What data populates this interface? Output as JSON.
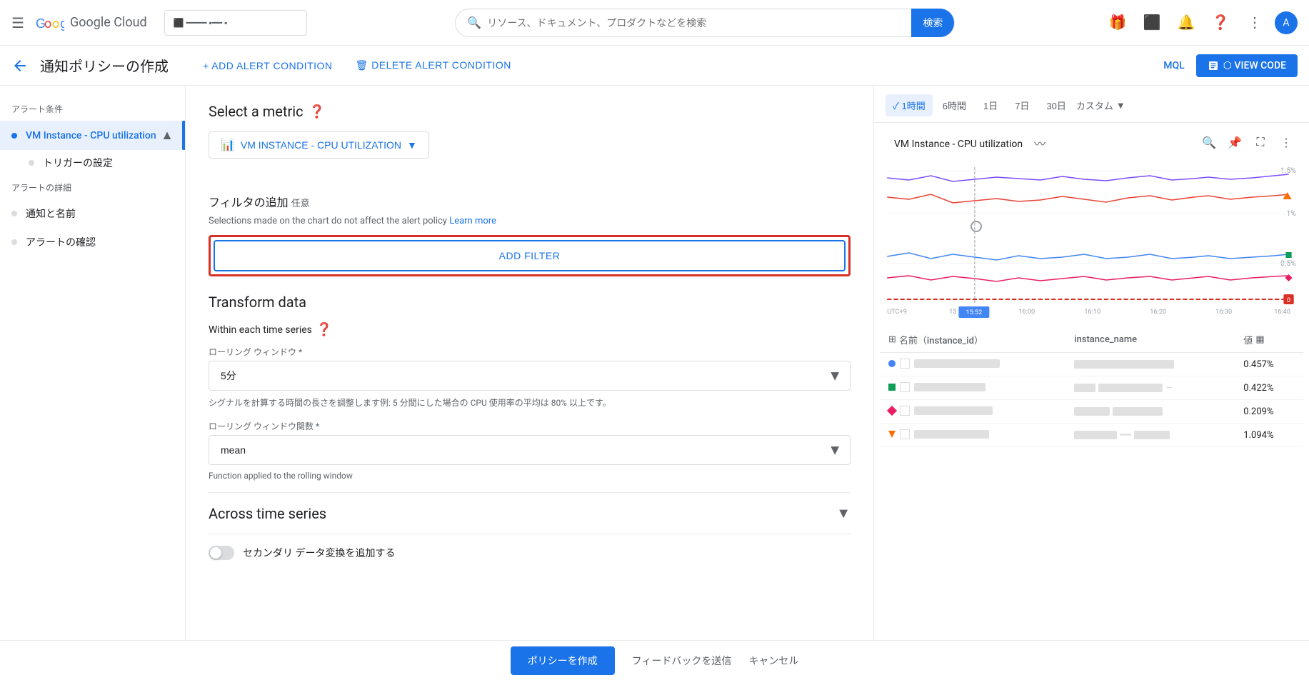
{
  "navbar": {
    "menu_icon": "☰",
    "logo_text": "Google Cloud",
    "search_placeholder": "リソース、ドキュメント、プロダクトなどを検索",
    "search_btn_label": "検索",
    "project_selector_text": "● ▪ ━━ ▪",
    "icons": [
      "gift",
      "monitor",
      "bell",
      "help",
      "more",
      "avatar"
    ]
  },
  "subheader": {
    "back_icon": "←",
    "page_title": "通知ポリシーの作成",
    "add_condition_label": "+ ADD ALERT CONDITION",
    "delete_condition_label": "🗑 DELETE ALERT CONDITION",
    "mql_label": "MQL",
    "view_code_label": "⬡ VIEW CODE"
  },
  "sidebar": {
    "alert_conditions_title": "アラート条件",
    "main_item_label": "VM Instance - CPU utilization",
    "sub_item_label": "トリガーの設定",
    "alert_details_title": "アラートの詳細",
    "notifications_label": "通知と名前",
    "review_label": "アラートの確認"
  },
  "main": {
    "metric_title": "Select a metric",
    "metric_btn_label": "VM INSTANCE - CPU UTILIZATION",
    "filter_title": "フィルタの追加",
    "filter_optional": "任意",
    "filter_description": "Selections made on the chart do not affect the alert policy",
    "filter_learn_more": "Learn more",
    "add_filter_label": "ADD FILTER",
    "transform_title": "Transform data",
    "within_series_title": "Within each time series",
    "rolling_window_label": "ローリング ウィンドウ *",
    "rolling_window_value": "5分",
    "rolling_window_hint": "シグナルを計算する時間の長さを調整します例: 5 分間にした場合の CPU 使用率の平均は 80% 以上です。",
    "rolling_fn_label": "ローリング ウィンドウ関数 *",
    "rolling_fn_value": "mean",
    "rolling_fn_hint": "Function applied to the rolling window",
    "across_series_title": "Across time series",
    "secondary_label": "セカンダリ データ変換を追加する"
  },
  "bottom_bar": {
    "create_label": "ポリシーを作成",
    "feedback_label": "フィードバックを送信",
    "cancel_label": "キャンセル"
  },
  "chart": {
    "title": "VM Instance - CPU utilization",
    "time_options": [
      "1時間",
      "6時間",
      "1日",
      "7日",
      "30日",
      "カスタム"
    ],
    "active_time": "1時間",
    "y_labels": [
      "1.5%",
      "1%",
      "0.5%",
      "0"
    ],
    "x_labels": [
      "15:52",
      "16:00",
      "16:10",
      "16:20",
      "16:30",
      "16:40"
    ],
    "table_headers": [
      "名前（instance_id）",
      "instance_name",
      "値"
    ],
    "rows": [
      {
        "color": "#4285f4",
        "type": "dot",
        "value": "0.457%"
      },
      {
        "color": "#0f9d58",
        "type": "square",
        "value": "0.422%"
      },
      {
        "color": "#ea4335",
        "type": "diamond",
        "value": "0.209%"
      },
      {
        "color": "#ff6d00",
        "type": "triangle-down",
        "value": "1.094%"
      }
    ]
  }
}
